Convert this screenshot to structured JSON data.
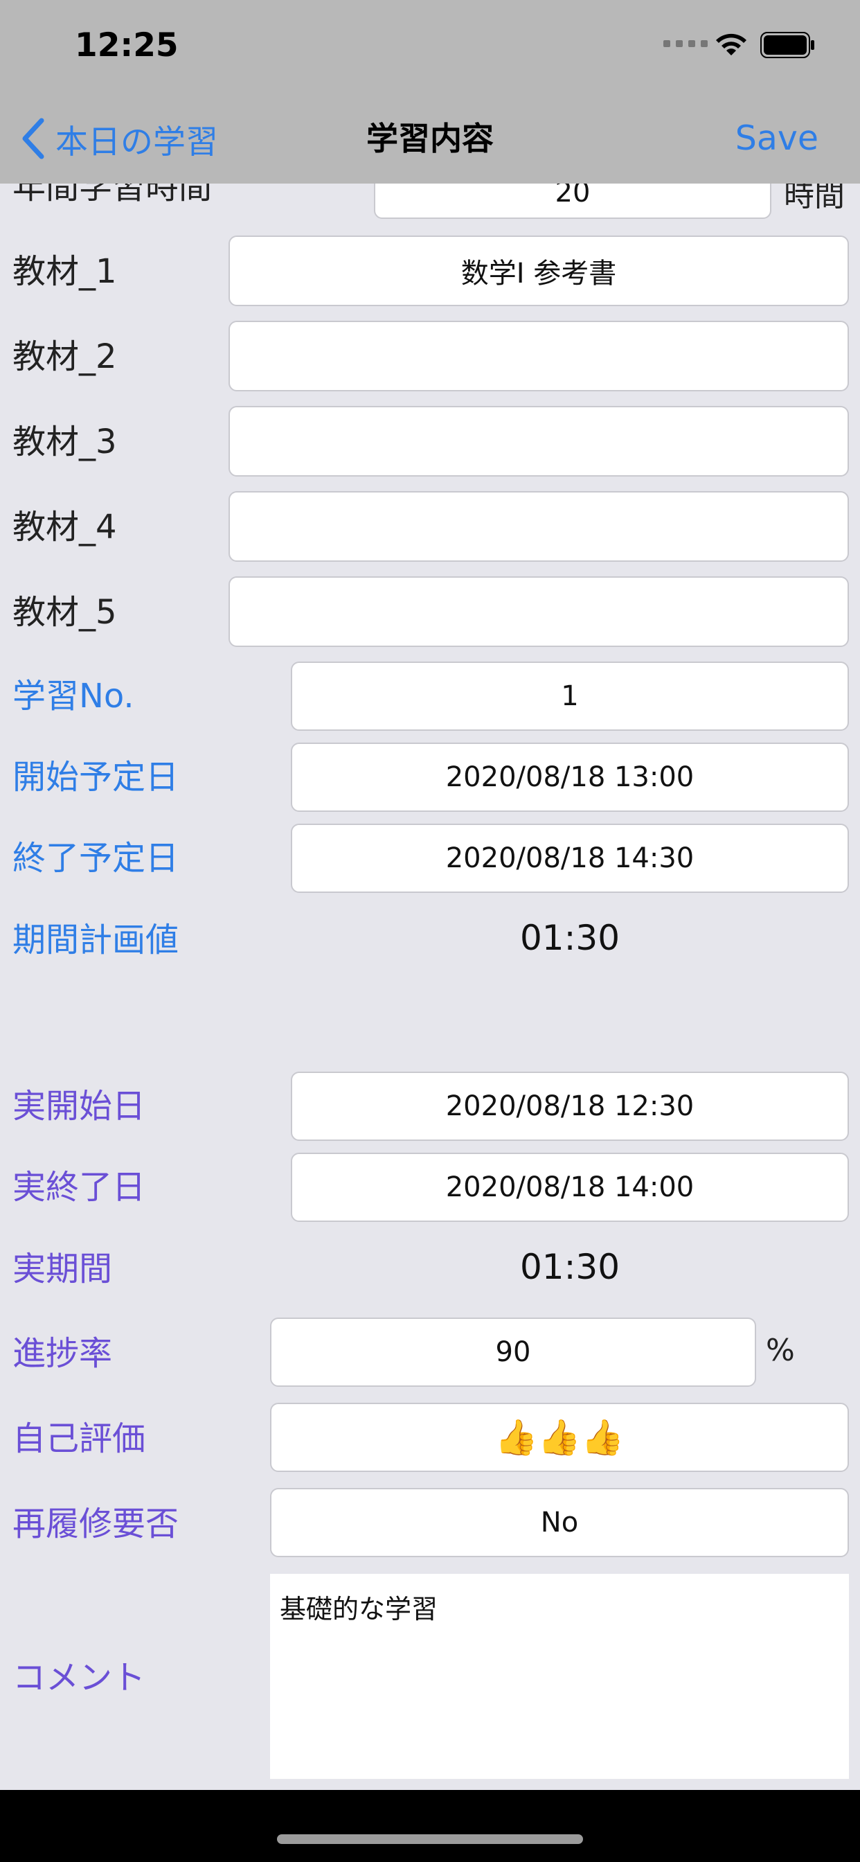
{
  "status_bar": {
    "time": "12:25"
  },
  "nav": {
    "back_label": "本日の学習",
    "title": "学習内容",
    "save_label": "Save"
  },
  "annual_hours": {
    "label": "年間学習時間",
    "value": "20",
    "unit": "時間"
  },
  "materials": [
    {
      "label": "教材_1",
      "value": "数学I 参考書"
    },
    {
      "label": "教材_2",
      "value": ""
    },
    {
      "label": "教材_3",
      "value": ""
    },
    {
      "label": "教材_4",
      "value": ""
    },
    {
      "label": "教材_5",
      "value": ""
    }
  ],
  "plan": {
    "number_label": "学習No.",
    "number_value": "1",
    "start_label": "開始予定日",
    "start_value": "2020/08/18 13:00",
    "end_label": "終了予定日",
    "end_value": "2020/08/18 14:30",
    "duration_label": "期間計画値",
    "duration_value": "01:30"
  },
  "actual": {
    "start_label": "実開始日",
    "start_value": "2020/08/18 12:30",
    "end_label": "実終了日",
    "end_value": "2020/08/18 14:00",
    "duration_label": "実期間",
    "duration_value": "01:30",
    "progress_label": "進捗率",
    "progress_value": "90",
    "progress_unit": "%",
    "rating_label": "自己評価",
    "rating_value": "👍👍👍",
    "retake_label": "再履修要否",
    "retake_value": "No",
    "comment_label": "コメント",
    "comment_value": "基礎的な学習"
  },
  "colors": {
    "blue": "#2f7ee6",
    "purple": "#6a4fd6",
    "header": "#b8b8b8"
  }
}
